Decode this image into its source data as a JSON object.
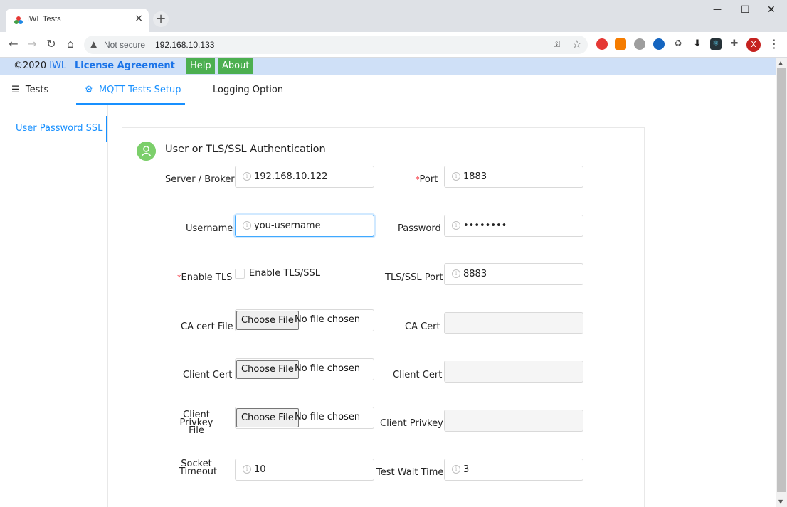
{
  "browser": {
    "tab_title": "IWL Tests",
    "tab_close": "×",
    "new_tab": "+",
    "win_min": "—",
    "win_max": "☐",
    "win_close": "✕",
    "security_label": "Not secure",
    "url": "192.168.10.133",
    "profile_initial": "X"
  },
  "header": {
    "copyright": "©2020",
    "copyright_link": "IWL",
    "license": "License Agreement",
    "help": "Help",
    "about": "About"
  },
  "tabs": [
    {
      "label": "Tests",
      "icon": "list-icon"
    },
    {
      "label": "MQTT Tests Setup",
      "icon": "gear-icon",
      "active": true
    },
    {
      "label": "Logging Option"
    }
  ],
  "sidebar": {
    "items": [
      {
        "label": "User Password SSL"
      }
    ]
  },
  "card": {
    "title": "User or TLS/SSL Authentication"
  },
  "form": {
    "server_label": "Server / Broker",
    "server_value": "192.168.10.122",
    "port_label": "Port",
    "port_value": "1883",
    "username_label": "Username",
    "username_value": "you-username",
    "password_label": "Password",
    "password_value": "••••••••",
    "enable_tls_label": "Enable TLS",
    "enable_tls_checkbox_label": "Enable TLS/SSL",
    "tls_port_label": "TLS/SSL Port",
    "tls_port_value": "8883",
    "ca_file_label": "CA cert File",
    "ca_cert_label": "CA Cert",
    "client_cert_file_label": "Client Cert",
    "client_cert_label": "Client Cert",
    "client_privkey_file_label_1": "Client Privkey",
    "client_privkey_file_label_2": "File",
    "client_privkey_label": "Client Privkey",
    "socket_timeout_label_1": "Socket",
    "socket_timeout_label_2": "Timeout",
    "socket_timeout_value": "10",
    "test_wait_label": "Test Wait Time",
    "test_wait_value": "3",
    "choose_file": "Choose File",
    "no_file": "No file chosen",
    "required_mark": "*",
    "info_glyph": "i"
  },
  "colors": {
    "accent": "#1890ff",
    "header_bg": "#cfe0f7",
    "button_green": "#4caf50",
    "avatar_green": "#7ccf6b"
  }
}
